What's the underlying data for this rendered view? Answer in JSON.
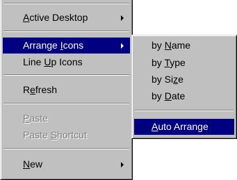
{
  "main_menu": {
    "items": [
      {
        "pre": "",
        "key": "A",
        "post": "ctive Desktop",
        "state": "normal",
        "submenu": true
      },
      {
        "pre": "Arrange ",
        "key": "I",
        "post": "cons",
        "state": "selected",
        "submenu": true
      },
      {
        "pre": "Line ",
        "key": "U",
        "post": "p Icons",
        "state": "normal",
        "submenu": false
      },
      {
        "pre": "R",
        "key": "e",
        "post": "fresh",
        "state": "normal",
        "submenu": false
      },
      {
        "pre": "",
        "key": "P",
        "post": "aste",
        "state": "disabled",
        "submenu": false
      },
      {
        "pre": "Paste ",
        "key": "S",
        "post": "hortcut",
        "state": "disabled",
        "submenu": false
      },
      {
        "pre": "",
        "key": "N",
        "post": "ew",
        "state": "normal",
        "submenu": true
      }
    ]
  },
  "sub_menu": {
    "items": [
      {
        "pre": "by ",
        "key": "N",
        "post": "ame",
        "state": "normal"
      },
      {
        "pre": "by ",
        "key": "T",
        "post": "ype",
        "state": "normal"
      },
      {
        "pre": "by Si",
        "key": "z",
        "post": "e",
        "state": "normal"
      },
      {
        "pre": "by ",
        "key": "D",
        "post": "ate",
        "state": "normal"
      },
      {
        "pre": "",
        "key": "A",
        "post": "uto Arrange",
        "state": "selected"
      }
    ]
  },
  "colors": {
    "menu_face": "#c0c0c0",
    "highlight": "#000080",
    "highlight_text": "#ffffff",
    "disabled_text": "#808080"
  }
}
